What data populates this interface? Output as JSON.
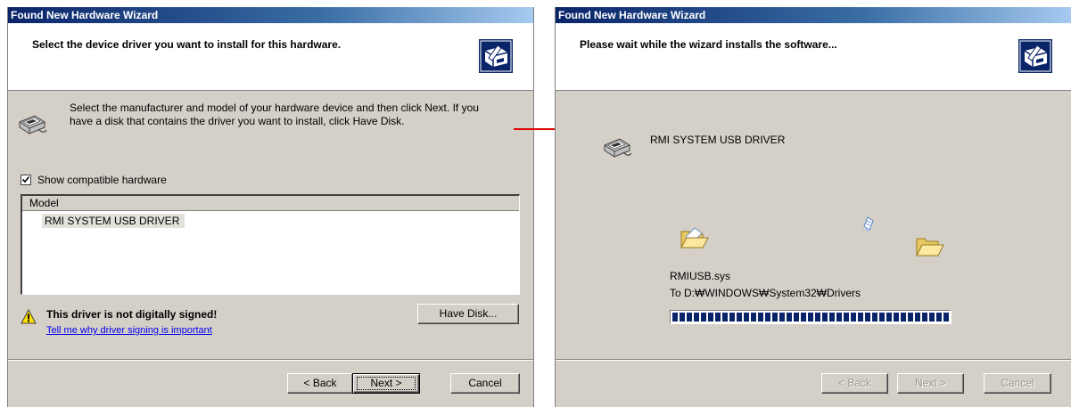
{
  "left_dialog": {
    "title": "Found New Hardware Wizard",
    "header": "Select the device driver you want to install for this hardware.",
    "instructions_line1": "Select the manufacturer and model of your hardware device and then click Next. If you",
    "instructions_line2": "have a disk that contains the driver you want to install, click Have Disk.",
    "checkbox_label": "Show compatible hardware",
    "checkbox_checked": true,
    "list_header": "Model",
    "list_items": [
      "RMI SYSTEM USB DRIVER"
    ],
    "warning_text": "This driver is not digitally signed!",
    "warning_link": "Tell me why driver signing is important",
    "have_disk_button": "Have Disk...",
    "back_button": "< Back",
    "next_button": "Next >",
    "cancel_button": "Cancel"
  },
  "right_dialog": {
    "title": "Found New Hardware Wizard",
    "header": "Please wait while the wizard installs the software...",
    "device_name": "RMI SYSTEM USB DRIVER",
    "file_name": "RMIUSB.sys",
    "destination": "To D:₩WINDOWS₩System32₩Drivers",
    "progress_percent": 100,
    "back_button": "< Back",
    "next_button": "Next >",
    "cancel_button": "Cancel"
  },
  "colors": {
    "titlebar": "#0a246a",
    "dialog_face": "#d4d0c8",
    "arrow": "#e00000",
    "link": "#0000ee",
    "progress": "#0a246a"
  },
  "icons": {
    "wizard": "hardware-wizard-icon",
    "device": "usb-device-icon",
    "warning": "warning-icon",
    "folder_open": "open-folder-icon",
    "folder": "folder-icon",
    "flying_doc": "document-icon",
    "arrow": "arrow-right-icon"
  }
}
